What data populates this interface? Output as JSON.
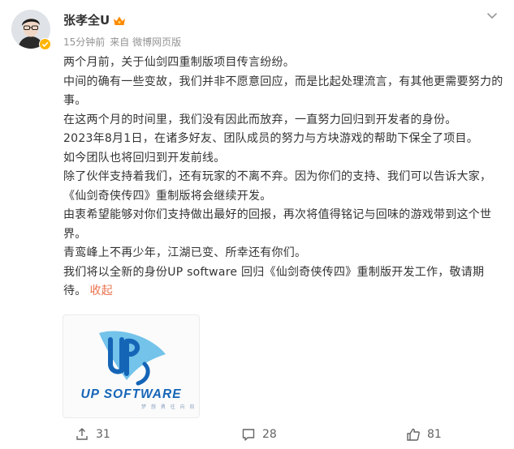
{
  "post": {
    "author": "张孝全U",
    "time": "15分钟前",
    "source": "来自 微博网页版"
  },
  "content": {
    "lines": [
      "两个月前，关于仙剑四重制版项目传言纷纷。",
      "中间的确有一些变故，我们并非不愿意回应，而是比起处理流言，有其他更需要努力的事。",
      "在这两个月的时间里，我们没有因此而放弃，一直努力回归到开发者的身份。",
      "2023年8月1日，在诸多好友、团队成员的努力与方块游戏的帮助下保全了项目。",
      "如今团队也将回归到开发前线。",
      "除了伙伴支持着我们，还有玩家的不离不弃。因为你们的支持、我们可以告诉大家，《仙剑奇侠传四》重制版将会继续开发。",
      "由衷希望能够对你们支持做出最好的回报，再次将值得铭记与回味的游戏带到这个世界。",
      "青鸾峰上不再少年，江湖已变、所幸还有你们。",
      "我们将以全新的身份UP software 回归《仙剑奇侠传四》重制版开发工作，敬请期待。"
    ],
    "collapse_label": "收起"
  },
  "image": {
    "wordmark": "UP SOFTWARE",
    "tagline": "梦 想    勇 往    向 前",
    "colors": {
      "blue": "#1565b7",
      "light_blue": "#5bb8e6"
    }
  },
  "actions": {
    "share_count": "31",
    "comment_count": "28",
    "like_count": "81"
  },
  "icons": [
    "avatar",
    "verified-icon",
    "crown-icon",
    "chevron-down-icon",
    "share-icon",
    "comment-icon",
    "like-icon"
  ],
  "colors": {
    "accent": "#eb7350",
    "meta": "#939393",
    "text": "#333333"
  }
}
